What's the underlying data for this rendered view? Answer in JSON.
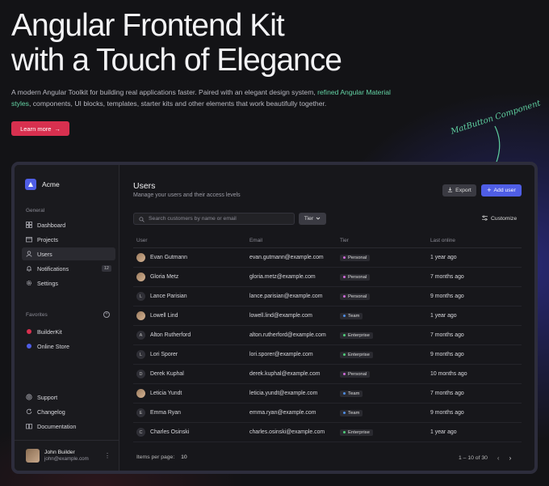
{
  "hero": {
    "title": "Angular Frontend Kit\nwith a Touch of Elegance",
    "desc_part1": "A modern Angular Toolkit for building real applications faster. Paired with an elegant design system, ",
    "desc_accent": "refined Angular Material styles",
    "desc_part2": ", components, UI blocks, templates, starter kits and other elements that work beautifully together.",
    "learn_more": "Learn more",
    "annotation": "MatButton Component"
  },
  "colors": {
    "accent": "#4f5ee6",
    "brand_red": "#d8304f",
    "green": "#63d1a3"
  },
  "sidebar": {
    "brand": "Acme",
    "general_label": "General",
    "items": [
      {
        "label": "Dashboard",
        "icon": "dashboard-icon"
      },
      {
        "label": "Projects",
        "icon": "folder-icon"
      },
      {
        "label": "Users",
        "icon": "user-icon",
        "active": true
      },
      {
        "label": "Notifications",
        "icon": "bell-icon",
        "badge": "12"
      },
      {
        "label": "Settings",
        "icon": "gear-icon"
      }
    ],
    "favorites_label": "Favorites",
    "favorites": [
      {
        "label": "BuilderKit",
        "color": "#d8304f"
      },
      {
        "label": "Online Store",
        "color": "#4f5ee6"
      }
    ],
    "bottom": [
      {
        "label": "Support",
        "icon": "lifebuoy-icon"
      },
      {
        "label": "Changelog",
        "icon": "refresh-icon"
      },
      {
        "label": "Documentation",
        "icon": "book-icon"
      }
    ],
    "user": {
      "name": "John Builder",
      "email": "john@example.com"
    }
  },
  "main": {
    "title": "Users",
    "subtitle": "Manage your users and their access levels",
    "export": "Export",
    "add_user": "Add user",
    "search_placeholder": "Search customers by name or email",
    "tier_filter": "Tier",
    "customize": "Customize",
    "columns": [
      "User",
      "Email",
      "Tier",
      "Last online"
    ],
    "rows": [
      {
        "name": "Evan Gutmann",
        "initial": "",
        "photo": true,
        "email": "evan.gutmann@example.com",
        "tier": "Personal",
        "last": "1 year ago"
      },
      {
        "name": "Gloria Metz",
        "initial": "",
        "photo": true,
        "email": "gloria.metz@example.com",
        "tier": "Personal",
        "last": "7 months ago"
      },
      {
        "name": "Lance Parisian",
        "initial": "L",
        "photo": false,
        "email": "lance.parisian@example.com",
        "tier": "Personal",
        "last": "9 months ago"
      },
      {
        "name": "Lowell Lind",
        "initial": "",
        "photo": true,
        "email": "lowell.lind@example.com",
        "tier": "Team",
        "last": "1 year ago"
      },
      {
        "name": "Alton Rutherford",
        "initial": "A",
        "photo": false,
        "email": "alton.rutherford@example.com",
        "tier": "Enterprise",
        "last": "7 months ago"
      },
      {
        "name": "Lori Sporer",
        "initial": "L",
        "photo": false,
        "email": "lori.sporer@example.com",
        "tier": "Enterprise",
        "last": "9 months ago"
      },
      {
        "name": "Derek Kuphal",
        "initial": "D",
        "photo": false,
        "email": "derek.kuphal@example.com",
        "tier": "Personal",
        "last": "10 months ago"
      },
      {
        "name": "Leticia Yundt",
        "initial": "",
        "photo": true,
        "email": "leticia.yundt@example.com",
        "tier": "Team",
        "last": "7 months ago"
      },
      {
        "name": "Emma Ryan",
        "initial": "E",
        "photo": false,
        "email": "emma.ryan@example.com",
        "tier": "Team",
        "last": "9 months ago"
      },
      {
        "name": "Charles Osinski",
        "initial": "C",
        "photo": false,
        "email": "charles.osinski@example.com",
        "tier": "Enterprise",
        "last": "1 year ago"
      }
    ],
    "tier_colors": {
      "Personal": "#d06ad8",
      "Team": "#4f8ee6",
      "Enterprise": "#4fcf7a"
    },
    "items_per_page_label": "Items per page:",
    "items_per_page": "10",
    "range": "1 – 10 of 30"
  }
}
